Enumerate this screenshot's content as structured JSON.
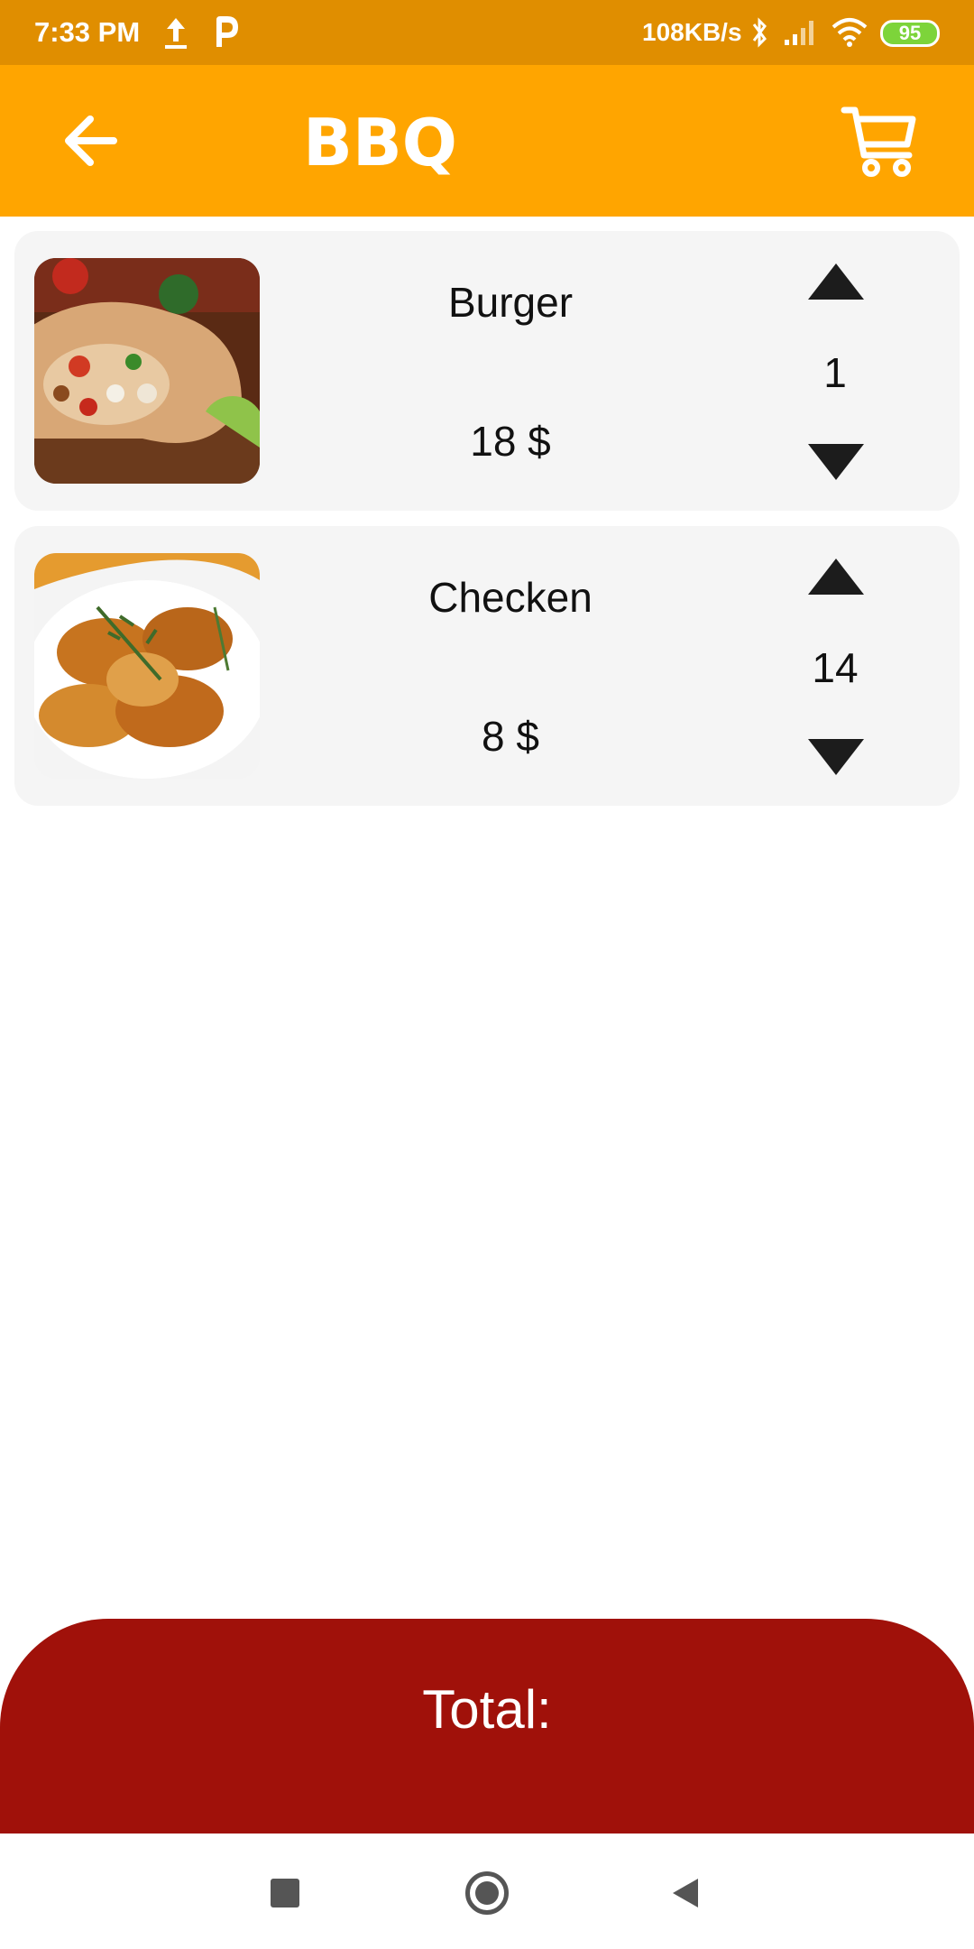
{
  "status_bar": {
    "time": "7:33 PM",
    "network_speed": "108KB/s",
    "battery": "95",
    "icons": [
      "upload-icon",
      "p-icon",
      "bluetooth-icon",
      "signal-icon",
      "wifi-icon",
      "battery-icon"
    ]
  },
  "app_bar": {
    "title": "BBQ",
    "back_icon": "arrow-left-icon",
    "cart_icon": "cart-icon",
    "color": "#ffa500"
  },
  "items": [
    {
      "name": "Burger",
      "price": "18 $",
      "quantity": "1",
      "image": "burrito-wrap-photo"
    },
    {
      "name": "Checken",
      "price": "8 $",
      "quantity": "14",
      "image": "chicken-wings-photo"
    }
  ],
  "footer": {
    "total_label": "Total:",
    "color": "#a0110a"
  },
  "nav_bar": {
    "icons": [
      "recents-icon",
      "home-icon",
      "back-icon"
    ]
  }
}
